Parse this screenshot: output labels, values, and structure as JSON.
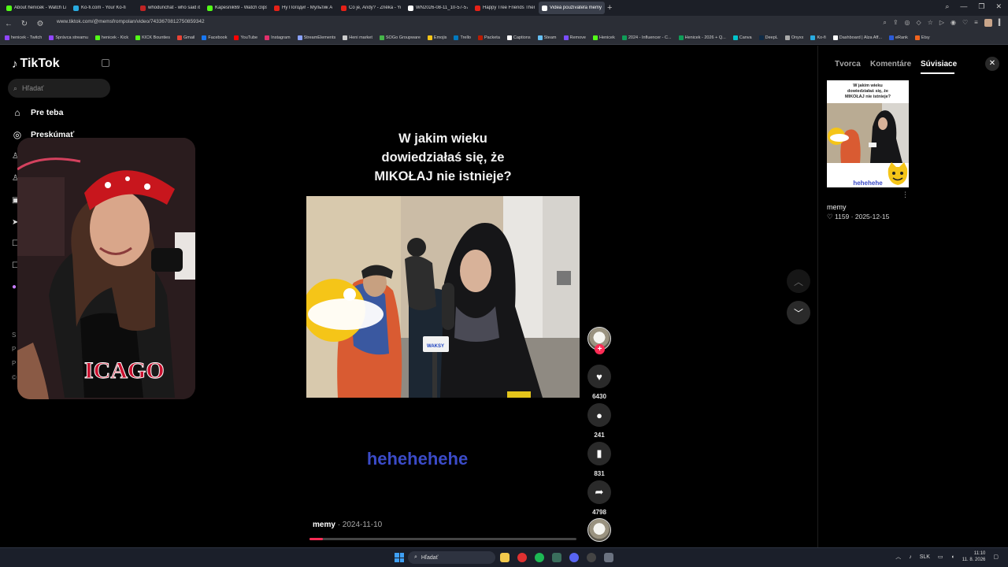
{
  "browser": {
    "tabs": [
      {
        "label": "About henicek - Watch Li",
        "color": "#53fc18"
      },
      {
        "label": "Ko-fi.com - Your Ko-fi",
        "color": "#29abe0"
      },
      {
        "label": "whodunchat - who said it",
        "color": "#c02424"
      },
      {
        "label": "Kapesnik69 - Watch clips",
        "color": "#53fc18"
      },
      {
        "label": "Ну Погоди! - Мультик А",
        "color": "#e62117"
      },
      {
        "label": "Co je, Andy? - Zně̇ka - Yo",
        "color": "#e62117"
      },
      {
        "label": "WN2026-08-11_10-57-57",
        "color": "#ffffff"
      },
      {
        "label": "Happy Tree Friends Them",
        "color": "#e62117"
      },
      {
        "label": "Videá používateľa memy",
        "color": "#ffffff",
        "active": true
      }
    ],
    "new_tab": "+",
    "url": "www.tiktok.com/@memsfrompolan/video/7433670812750859342",
    "bookmarks": [
      {
        "label": "henicek - Twitch",
        "color": "#9146ff"
      },
      {
        "label": "Správca streamu",
        "color": "#9146ff"
      },
      {
        "label": "henicek - Kick",
        "color": "#53fc18"
      },
      {
        "label": "KICK Bounties",
        "color": "#53fc18"
      },
      {
        "label": "Gmail",
        "color": "#ea4335"
      },
      {
        "label": "Facebook",
        "color": "#1877f2"
      },
      {
        "label": "YouTube",
        "color": "#ff0000"
      },
      {
        "label": "Instagram",
        "color": "#e1306c"
      },
      {
        "label": "StreamElements",
        "color": "#8aa2ff"
      },
      {
        "label": "Heni market",
        "color": "#cccccc"
      },
      {
        "label": "SOGo Groupware",
        "color": "#45b549"
      },
      {
        "label": "Emojis",
        "color": "#f5c518"
      },
      {
        "label": "Trello",
        "color": "#0079bf"
      },
      {
        "label": "Packeta",
        "color": "#ba1b02"
      },
      {
        "label": "Captions",
        "color": "#ffffff"
      },
      {
        "label": "Steam",
        "color": "#66c0f4"
      },
      {
        "label": "Remove",
        "color": "#7a4dff"
      },
      {
        "label": "Henicek",
        "color": "#53fc18"
      },
      {
        "label": "2024 - Influencer - C...",
        "color": "#0f9d58"
      },
      {
        "label": "Henicek - 2026 + Q...",
        "color": "#0f9d58"
      },
      {
        "label": "Canva",
        "color": "#00c4cc"
      },
      {
        "label": "DeepL",
        "color": "#0f2b46"
      },
      {
        "label": "Onyxx",
        "color": "#aaaaaa"
      },
      {
        "label": "Ko-fi",
        "color": "#29abe0"
      },
      {
        "label": "Dashboard | Alza Aff...",
        "color": "#ffffff"
      },
      {
        "label": "eRank",
        "color": "#2b5bd7"
      },
      {
        "label": "Etsy",
        "color": "#f1641e"
      }
    ]
  },
  "sidebar": {
    "logo": "TikTok",
    "search_placeholder": "Hľadať",
    "items": [
      {
        "label": "Pre teba",
        "icon": "home-icon"
      },
      {
        "label": "Preskúmať",
        "icon": "explore-icon"
      }
    ],
    "footer_letters": [
      "S",
      "P",
      "P",
      "©"
    ]
  },
  "video": {
    "title_lines": [
      "W jakim wieku",
      "dowiedziałaś się, że",
      "MIKOŁAJ nie istnieje?"
    ],
    "mic_label": "WAKSY",
    "caption": "hehehehehe",
    "author": "memy",
    "date": "2024-11-10",
    "progress": 0.05
  },
  "actions": {
    "likes": "6430",
    "comments": "241",
    "saves": "831",
    "shares": "4798",
    "follow": "+"
  },
  "right_panel": {
    "tabs": [
      "Tvorca",
      "Komentáre",
      "Súvisiace"
    ],
    "active_tab": "Súvisiace",
    "close": "✕",
    "thumb_title_lines": [
      "W jakim wieku",
      "dowiedziałaś się, że",
      "MIKOŁAJ nie istnieje?"
    ],
    "thumb_caption": "hehehehe",
    "more": "⋮",
    "author": "memy",
    "likes": "1159",
    "date": "2025-12-15"
  },
  "taskbar": {
    "search_placeholder": "Hľadať",
    "lang": "SLK",
    "time": "11:10",
    "date": "11. 8. 2026"
  }
}
